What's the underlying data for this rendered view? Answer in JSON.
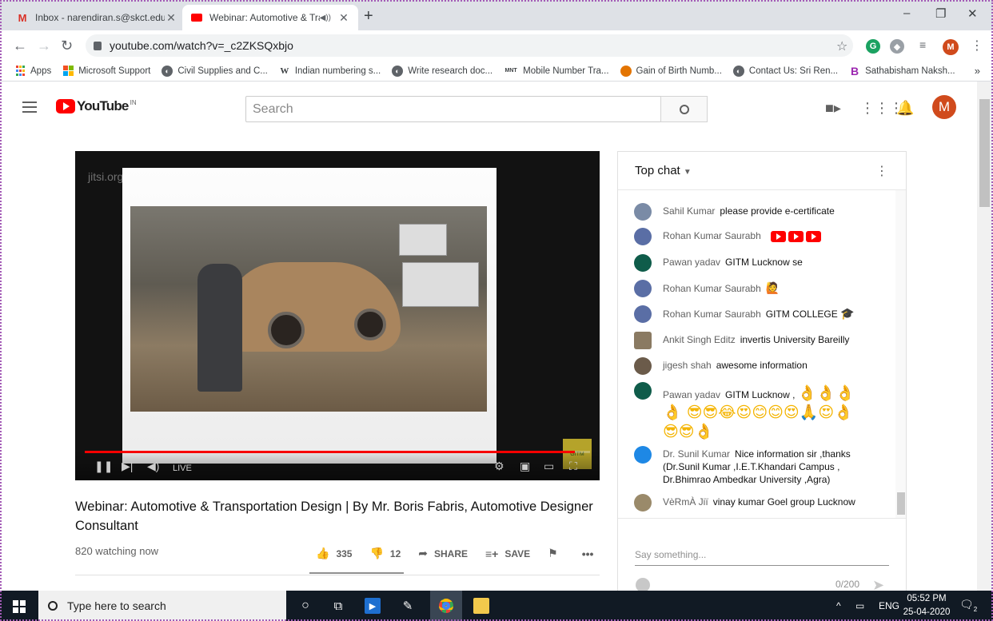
{
  "browser": {
    "tabs": [
      {
        "title": "Inbox - narendiran.s@skct.edu.in",
        "favicon": "gmail-icon",
        "active": false
      },
      {
        "title": "Webinar: Automotive & Tran",
        "favicon": "youtube-icon",
        "active": true
      }
    ],
    "new_tab": "+",
    "window_controls": [
      "–",
      "❐",
      "✕"
    ],
    "url": "youtube.com/watch?v=_c2ZKSQxbjo",
    "bookmarks": [
      {
        "label": "Apps",
        "icon": "apps-grid-icon"
      },
      {
        "label": "Microsoft Support",
        "icon": "microsoft-icon"
      },
      {
        "label": "Civil Supplies and C...",
        "icon": "globe-icon"
      },
      {
        "label": "Indian numbering s...",
        "icon": "wikipedia-icon"
      },
      {
        "label": "Write research doc...",
        "icon": "globe-icon"
      },
      {
        "label": "Mobile Number Tra...",
        "icon": "site-icon"
      },
      {
        "label": "Gain of Birth Numb...",
        "icon": "site-icon"
      },
      {
        "label": "Contact Us: Sri Ren...",
        "icon": "globe-icon"
      },
      {
        "label": "Sathabisham Naksh...",
        "icon": "site-b-icon"
      }
    ],
    "bookmarks_more": "»"
  },
  "youtube": {
    "logo_text": "YouTube",
    "country_code": "IN",
    "search_placeholder": "Search",
    "user_initial": "M"
  },
  "video": {
    "title": "Webinar: Automotive & Transportation Design | By Mr. Boris Fabris, Automotive Designer Consultant",
    "watching": "820 watching now",
    "likes": "335",
    "dislikes": "12",
    "share_label": "SHARE",
    "save_label": "SAVE",
    "live_label": "LIVE",
    "watermark": "jitsi.org",
    "progress": 0.97
  },
  "chat": {
    "header": "Top chat",
    "messages": [
      {
        "author": "Sahil Kumar",
        "text": "please provide e-certificate",
        "avatar_color": "#7a8ba6"
      },
      {
        "author": "Rohan Kumar Saurabh",
        "text": "",
        "badges": 3,
        "avatar_color": "#5a6ea5"
      },
      {
        "author": "Pawan yadav",
        "text": "GITM Lucknow se",
        "avatar_color": "#0f5c4a"
      },
      {
        "author": "Rohan Kumar Saurabh",
        "text": "",
        "emoji": "🙋",
        "avatar_color": "#5a6ea5"
      },
      {
        "author": "Rohan Kumar Saurabh",
        "text": "GITM COLLEGE",
        "emoji": "🎓",
        "avatar_color": "#5a6ea5"
      },
      {
        "author": "Ankit Singh Editz",
        "text": "invertis University Bareilly",
        "avatar_color": "#8a7a62"
      },
      {
        "author": "jigesh shah",
        "text": "awesome information",
        "avatar_color": "#6b5b4a"
      },
      {
        "author": "Pawan yadav",
        "text": "GITM Lucknow ,",
        "emoji": "👌👌👌👌 😎😎😂😍😊😊😍🙏😍👌 😎😎👌",
        "avatar_color": "#0f5c4a"
      },
      {
        "author": "Dr. Sunil Kumar",
        "text": "Nice information sir ,thanks (Dr.Sunil Kumar ,I.E.T.Khandari Campus , Dr.Bhimrao Ambedkar University ,Agra)",
        "avatar_color": "#1e88e5"
      },
      {
        "author": "VèRmÀ Jiï",
        "text": "vinay kumar Goel group Lucknow",
        "avatar_color": "#9a8a6a"
      }
    ],
    "input_placeholder": "Say something...",
    "char_counter": "0/200"
  },
  "taskbar": {
    "search_placeholder": "Type here to search",
    "language": "ENG",
    "time": "05:52 PM",
    "date": "25-04-2020",
    "notifications": "2"
  }
}
